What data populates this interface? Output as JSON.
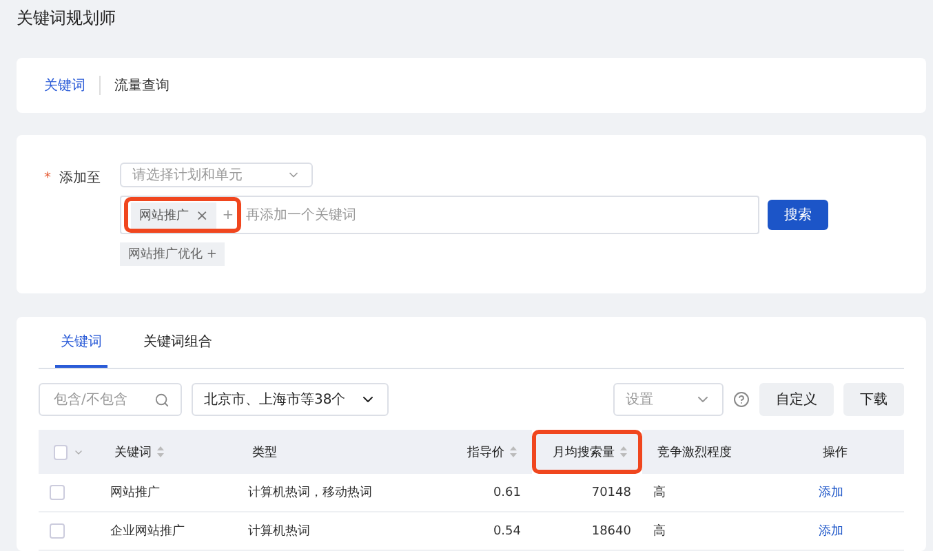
{
  "page_title": "关键词规划师",
  "top_tabs": [
    {
      "label": "关键词",
      "selected": true
    },
    {
      "label": "流量查询",
      "selected": false
    }
  ],
  "form": {
    "required_mark": "*",
    "label": "添加至",
    "plan_select": {
      "placeholder": "请选择计划和单元"
    },
    "keyword_input": {
      "tags": [
        {
          "label": "网站推广",
          "remove": "×"
        }
      ],
      "add_hint": "+",
      "placeholder": "再添加一个关键词",
      "highlighted": true
    },
    "search_button": "搜索",
    "suggestions": [
      {
        "label": "网站推广优化",
        "add": "+"
      }
    ]
  },
  "result_tabs": [
    {
      "label": "关键词",
      "selected": true
    },
    {
      "label": "关键词组合",
      "selected": false
    }
  ],
  "toolbar": {
    "filter": {
      "placeholder": "包含/不包含"
    },
    "region_select": "北京市、上海市等38个",
    "settings_select": {
      "placeholder": "设置"
    },
    "buttons": [
      "自定义",
      "下载"
    ]
  },
  "table": {
    "select_all": {
      "checked": false
    },
    "columns": [
      {
        "label": "关键词",
        "sortable": true,
        "kind": "text",
        "highlighted": false
      },
      {
        "label": "类型",
        "sortable": false,
        "kind": "text",
        "highlighted": false
      },
      {
        "label": "指导价",
        "sortable": true,
        "kind": "number",
        "highlighted": false
      },
      {
        "label": "月均搜索量",
        "sortable": true,
        "kind": "number",
        "highlighted": true
      },
      {
        "label": "竞争激烈程度",
        "sortable": false,
        "kind": "text",
        "highlighted": false
      },
      {
        "label": "操作",
        "sortable": false,
        "kind": "text",
        "highlighted": false
      }
    ],
    "rows": [
      {
        "checked": false,
        "cells": [
          "网站推广",
          "计算机热词，移动热词",
          "0.61",
          "70148",
          "高"
        ],
        "action": "添加"
      },
      {
        "checked": false,
        "cells": [
          "企业网站推广",
          "计算机热词",
          "0.54",
          "18640",
          "高"
        ],
        "action": "添加"
      }
    ]
  }
}
